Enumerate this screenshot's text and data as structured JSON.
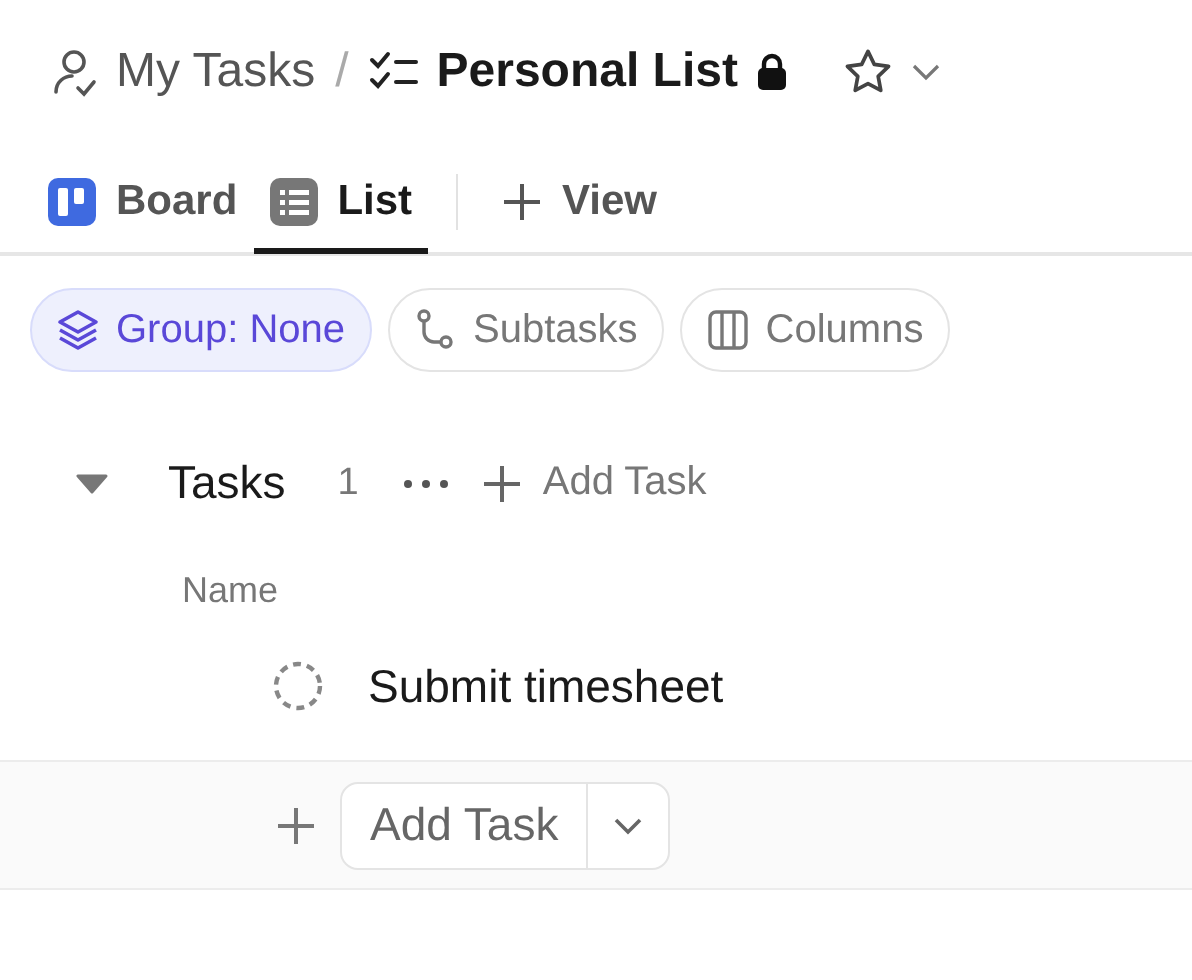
{
  "breadcrumb": {
    "parent": "My Tasks",
    "separator": "/",
    "title": "Personal List",
    "locked": true,
    "favorite": false
  },
  "views": [
    {
      "kind": "board",
      "label": "Board",
      "selected": false
    },
    {
      "kind": "list",
      "label": "List",
      "selected": true
    }
  ],
  "add_view": "View",
  "filters": [
    {
      "kind": "group",
      "label": "Group: None",
      "selected": true
    },
    {
      "kind": "subtasks",
      "label": "Subtasks",
      "selected": false
    },
    {
      "kind": "columns",
      "label": "Columns",
      "selected": false
    }
  ],
  "group": {
    "name": "Tasks",
    "count": "1",
    "expanded": true,
    "add_label": "Add Task"
  },
  "columns": [
    "Name"
  ],
  "tasks": [
    {
      "name": "Submit timesheet"
    }
  ],
  "add_task": "Add Task"
}
